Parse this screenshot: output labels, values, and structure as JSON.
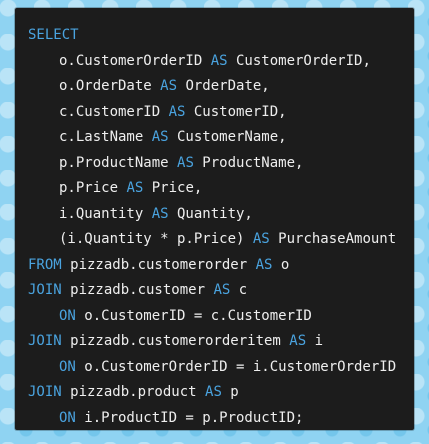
{
  "code": {
    "lines": [
      {
        "indent": false,
        "k1": "SELECT",
        "t1": "",
        "k2": "",
        "t2": ""
      },
      {
        "indent": true,
        "k1": "",
        "t1": "o.CustomerOrderID ",
        "k2": "AS",
        "t2": " CustomerOrderID,"
      },
      {
        "indent": true,
        "k1": "",
        "t1": "o.OrderDate ",
        "k2": "AS",
        "t2": " OrderDate,"
      },
      {
        "indent": true,
        "k1": "",
        "t1": "c.CustomerID ",
        "k2": "AS",
        "t2": " CustomerID,"
      },
      {
        "indent": true,
        "k1": "",
        "t1": "c.LastName ",
        "k2": "AS",
        "t2": " CustomerName,"
      },
      {
        "indent": true,
        "k1": "",
        "t1": "p.ProductName ",
        "k2": "AS",
        "t2": " ProductName,"
      },
      {
        "indent": true,
        "k1": "",
        "t1": "p.Price ",
        "k2": "AS",
        "t2": " Price,"
      },
      {
        "indent": true,
        "k1": "",
        "t1": "i.Quantity ",
        "k2": "AS",
        "t2": " Quantity,"
      },
      {
        "indent": true,
        "k1": "",
        "t1": "(i.Quantity * p.Price) ",
        "k2": "AS",
        "t2": " PurchaseAmount"
      },
      {
        "indent": false,
        "k1": "FROM",
        "t1": " pizzadb.customerorder ",
        "k2": "AS",
        "t2": " o"
      },
      {
        "indent": false,
        "k1": "JOIN",
        "t1": " pizzadb.customer ",
        "k2": "AS",
        "t2": " c"
      },
      {
        "indent": true,
        "k1": "ON",
        "t1": " o.CustomerID = c.CustomerID",
        "k2": "",
        "t2": ""
      },
      {
        "indent": false,
        "k1": "JOIN",
        "t1": " pizzadb.customerorderitem ",
        "k2": "AS",
        "t2": " i"
      },
      {
        "indent": true,
        "k1": "ON",
        "t1": " o.CustomerOrderID = i.CustomerOrderID",
        "k2": "",
        "t2": ""
      },
      {
        "indent": false,
        "k1": "JOIN",
        "t1": " pizzadb.product ",
        "k2": "AS",
        "t2": " p"
      },
      {
        "indent": true,
        "k1": "ON",
        "t1": " i.ProductID = p.ProductID;",
        "k2": "",
        "t2": ""
      }
    ]
  },
  "colors": {
    "keyword": "#4aa3df",
    "text": "#eeeeee",
    "panel": "#1c1c1c",
    "background": "#8fd3f2"
  }
}
